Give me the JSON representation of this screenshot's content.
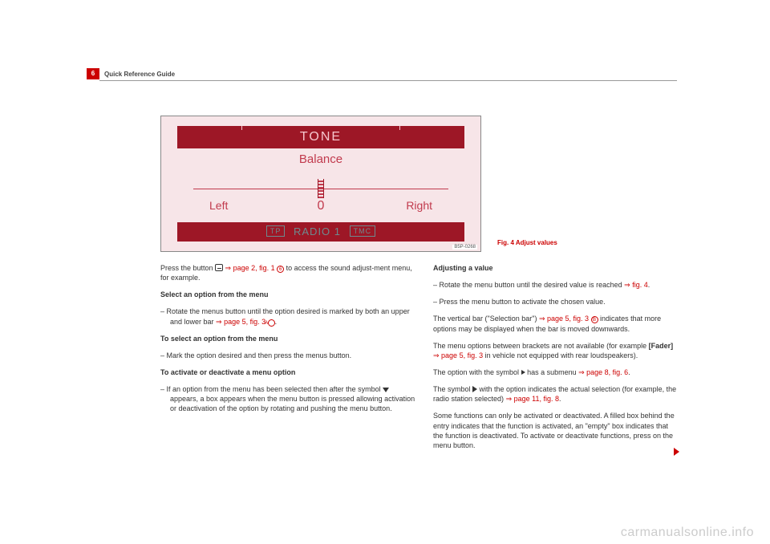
{
  "page": {
    "number": "6",
    "title": "Quick Reference Guide"
  },
  "display": {
    "title": "TONE",
    "subtitle": "Balance",
    "left": "Left",
    "right": "Right",
    "value": "0",
    "badge1": "TP",
    "source": "RADIO 1",
    "badge2": "TMC",
    "image_id": "B5P-0268"
  },
  "fig_caption": "Fig. 4  Adjust values",
  "left_col": {
    "p1a": "Press the button ",
    "p1_ref": " ⇒ page 2, fig. 1 ",
    "p1_circ": "6",
    "p1b": " to access the sound adjust-ment menu, for example.",
    "h1": "Select an option from the menu",
    "b1a": "–   Rotate the menus button until the option desired is marked by both an upper and lower bar ",
    "b1_ref": "⇒ page 5, fig. 3 ",
    "b1_circ": "A",
    "b1b": ".",
    "h2": "To select an option from the menu",
    "b2": "–   Mark the option desired and then press the menus button.",
    "h3": "To activate or deactivate a menu option",
    "b3a": "–   If an option from the menu has been selected then after the symbol ",
    "b3b": " appears, a box appears when the menu button is pressed allowing activation or deactivation of the option by rotating and pushing the menu button."
  },
  "right_col": {
    "h1": "Adjusting a value",
    "b1a": "–   Rotate the menu button until the desired value is reached ",
    "b1_ref": "⇒ fig. 4",
    "b1b": ".",
    "b2": "–   Press the menu button to activate the chosen value.",
    "p2a": "The vertical bar (\"Selection bar\") ",
    "p2_ref": "⇒ page 5, fig. 3 ",
    "p2_circ": "B",
    "p2b": " indicates that more options may be displayed when the bar is moved downwards.",
    "p3a": "The menu options between brackets are not available (for example ",
    "p3_bold": "[Fader]",
    "p3b": " ",
    "p3_ref": "⇒ page 5, fig. 3",
    "p3c": " in vehicle not equipped with rear loudspeakers).",
    "p4a": "The option with the symbol ",
    "p4b": " has a submenu ",
    "p4_ref": "⇒ page 8, fig. 6",
    "p4c": ".",
    "p5a": "The symbol ",
    "p5b": " with the option indicates the actual selection (for example, the radio station selected) ",
    "p5_ref": "⇒ page 11, fig. 8",
    "p5c": ".",
    "p6": "Some functions can only be activated or deactivated. A filled box behind the entry indicates that the function is activated, an \"empty\" box indicates that the function is deactivated. To activate or deactivate functions, press on the menu button."
  },
  "watermark": "carmanualsonline.info"
}
